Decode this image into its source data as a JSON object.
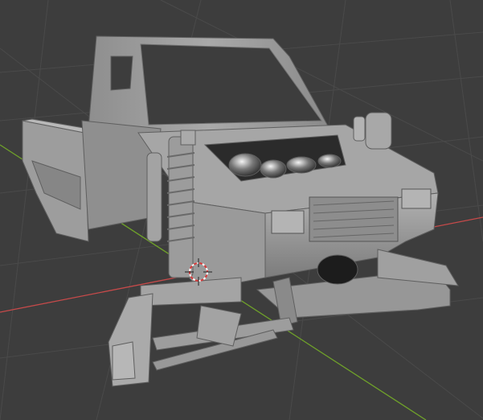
{
  "viewport": {
    "background": "#3d3d3d",
    "grid_color": "#4a4a4a",
    "x_axis_color": "#c64a4a",
    "y_axis_color": "#6fa12a"
  },
  "scene": {
    "object": "truck-model",
    "model_color": "#9c9c9c",
    "cursor": "3d-cursor-icon"
  }
}
